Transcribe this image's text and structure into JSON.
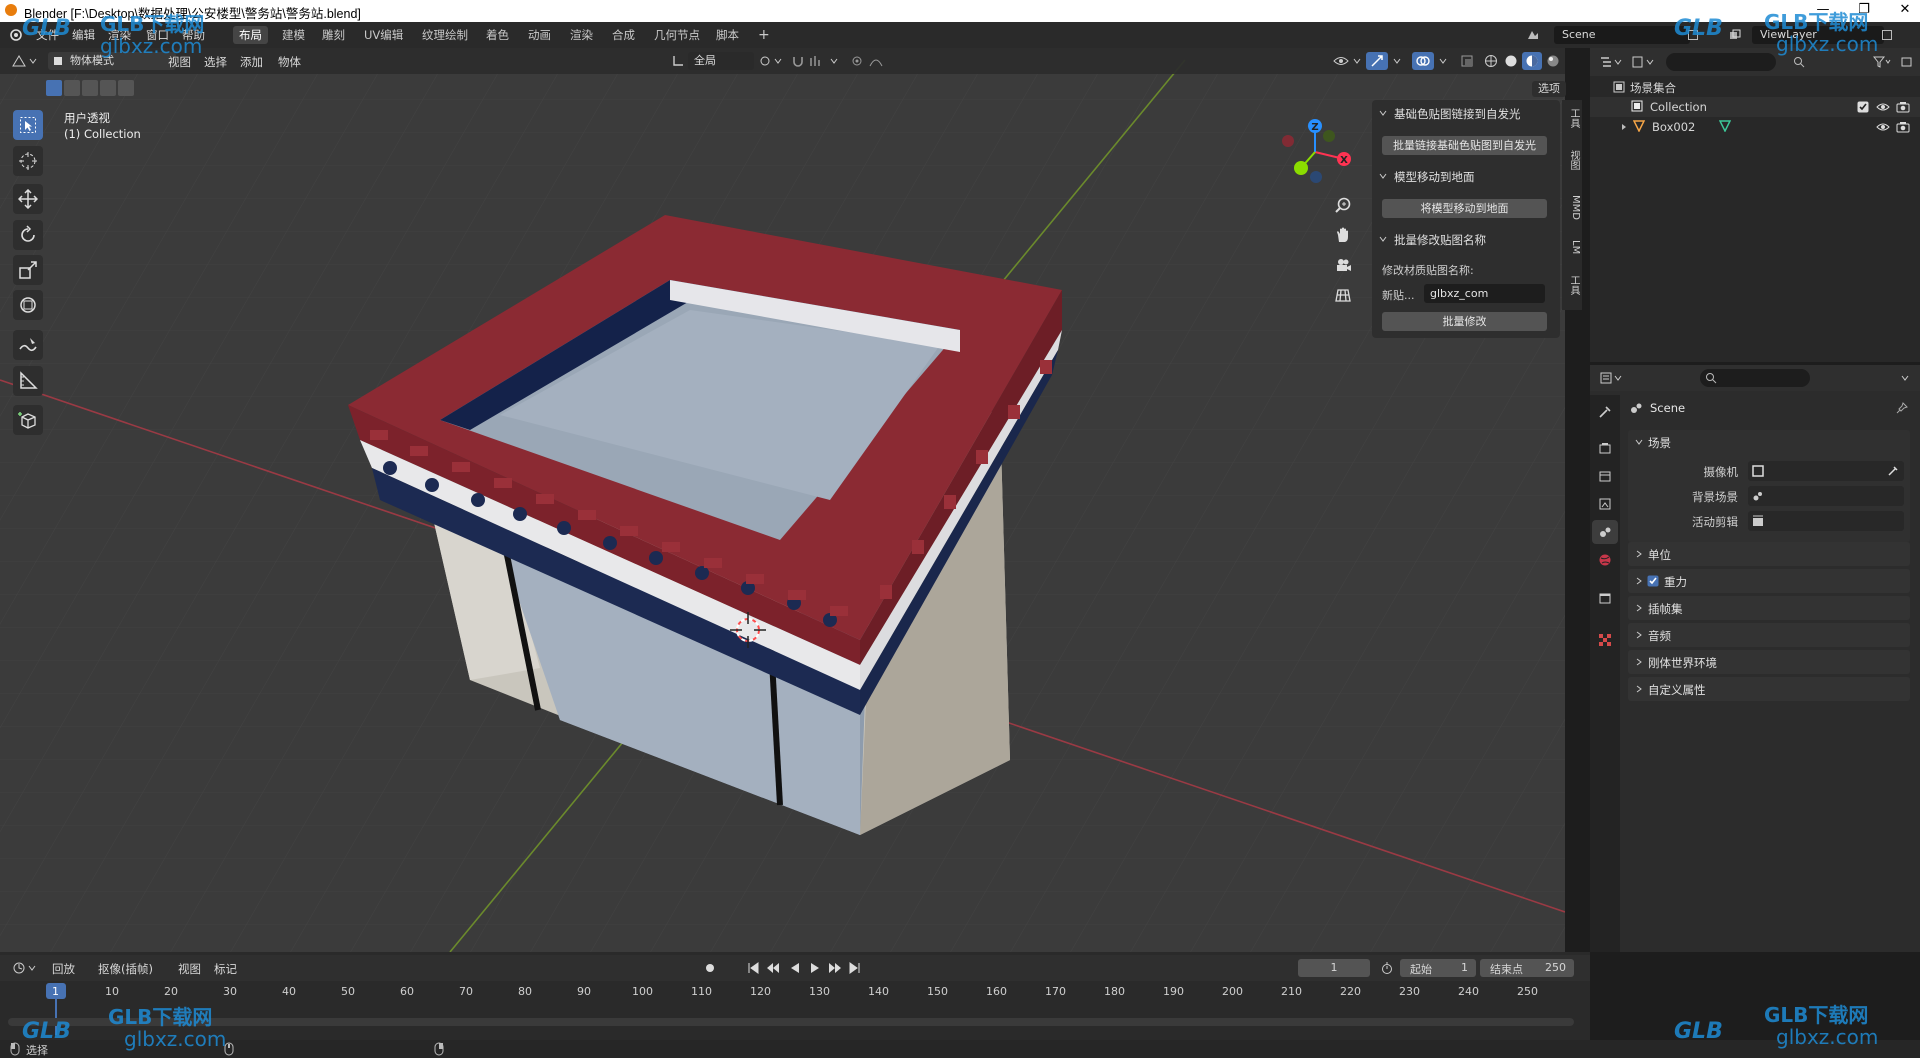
{
  "window": {
    "title": "Blender [F:\\Desktop\\数据处理\\公安楼型\\警务站\\警务站.blend]",
    "minimize": "—",
    "maximize": "❐",
    "close": "✕"
  },
  "menus": [
    "文件",
    "编辑",
    "渲染",
    "窗口",
    "帮助"
  ],
  "workspaces": [
    {
      "label": "布局",
      "active": true
    },
    {
      "label": "建模",
      "active": false
    },
    {
      "label": "雕刻",
      "active": false
    },
    {
      "label": "UV编辑",
      "active": false
    },
    {
      "label": "纹理绘制",
      "active": false
    },
    {
      "label": "着色",
      "active": false
    },
    {
      "label": "动画",
      "active": false
    },
    {
      "label": "渲染",
      "active": false
    },
    {
      "label": "合成",
      "active": false
    },
    {
      "label": "几何节点",
      "active": false
    },
    {
      "label": "脚本",
      "active": false
    }
  ],
  "add_workspace": "+",
  "scene_field": "Scene",
  "viewlayer_field": "ViewLayer",
  "viewport": {
    "mode": "物体模式",
    "menus": [
      "视图",
      "选择",
      "添加",
      "物体"
    ],
    "transform_orientation": "全局",
    "options": "选项",
    "overlay_view": "用户透视",
    "overlay_collection": "(1) Collection",
    "gizmo_axes": {
      "x": "X",
      "y": "Y",
      "z": "Z"
    }
  },
  "npanel": {
    "sections": [
      {
        "title": "基础色贴图链接到自发光",
        "button": "批量链接基础色贴图到自发光"
      },
      {
        "title": "模型移动到地面",
        "button": "将模型移动到地面"
      },
      {
        "title": "批量修改贴图名称",
        "field_caption": "修改材质贴图名称:",
        "field_label": "新贴...",
        "field_value": "glbxz_com",
        "button": "批量修改"
      }
    ],
    "tabs": [
      "工具",
      "视图",
      "MMD",
      "LM",
      "工具"
    ]
  },
  "outliner": {
    "root": "场景集合",
    "items": [
      {
        "label": "Collection",
        "type": "collection"
      },
      {
        "label": "Box002",
        "type": "mesh"
      }
    ]
  },
  "properties": {
    "context": "Scene",
    "sections": [
      {
        "label": "场景",
        "expanded": true
      },
      {
        "label": "单位",
        "expanded": false
      },
      {
        "label": "重力",
        "expanded": false,
        "checkbox": true
      },
      {
        "label": "插帧集",
        "expanded": false
      },
      {
        "label": "音频",
        "expanded": false
      },
      {
        "label": "刚体世界环境",
        "expanded": false
      },
      {
        "label": "自定义属性",
        "expanded": false
      }
    ],
    "scene_fields": [
      {
        "label": "摄像机"
      },
      {
        "label": "背景场景"
      },
      {
        "label": "活动剪辑"
      }
    ]
  },
  "timeline": {
    "menus": [
      "回放",
      "抠像(插帧)",
      "视图",
      "标记"
    ],
    "current_frame": "1",
    "start_label": "起始",
    "start_value": "1",
    "end_label": "结束点",
    "end_value": "250",
    "ruler": [
      "1",
      "10",
      "20",
      "30",
      "40",
      "50",
      "60",
      "70",
      "80",
      "90",
      "100",
      "110",
      "120",
      "130",
      "140",
      "150",
      "160",
      "170",
      "180",
      "190",
      "200",
      "210",
      "220",
      "230",
      "240",
      "250"
    ]
  },
  "status": {
    "left": "选择"
  },
  "watermarks": {
    "brand": "GLB下载网",
    "url": "glbxz.com",
    "logo": "GLB"
  },
  "colors": {
    "accent": "#4772b3",
    "axis_x": "#ff3352",
    "axis_y": "#8bdc00",
    "axis_z": "#2890ff",
    "roof_red": "#8b2a33",
    "navy": "#1c2a52",
    "watermark": "#1e8bd4"
  }
}
